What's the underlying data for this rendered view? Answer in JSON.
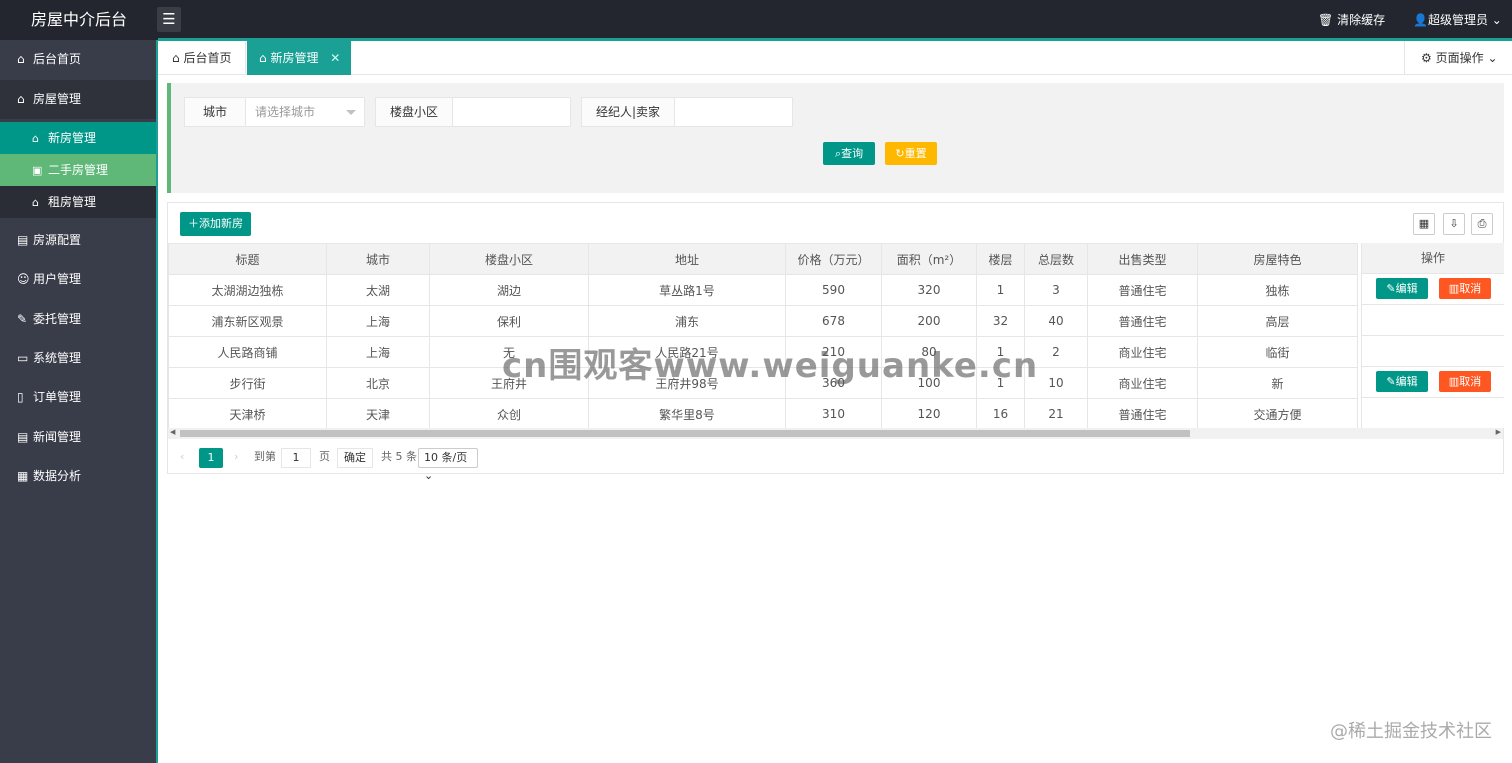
{
  "header": {
    "logo": "房屋中介后台",
    "menu_toggle_icon": "hamburger-icon",
    "clear_cache": "清除缓存",
    "user": "超级管理员"
  },
  "sidebar": {
    "items": [
      {
        "label": "后台首页",
        "icon": "home-icon"
      },
      {
        "label": "房屋管理",
        "icon": "house-icon"
      },
      {
        "label": "房源配置",
        "icon": "config-icon"
      },
      {
        "label": "用户管理",
        "icon": "user-icon"
      },
      {
        "label": "委托管理",
        "icon": "delegate-icon"
      },
      {
        "label": "系统管理",
        "icon": "system-icon"
      },
      {
        "label": "订单管理",
        "icon": "order-icon"
      },
      {
        "label": "新闻管理",
        "icon": "news-icon"
      },
      {
        "label": "数据分析",
        "icon": "chart-icon"
      }
    ],
    "sub_items": [
      {
        "label": "新房管理",
        "icon": "home-icon"
      },
      {
        "label": "二手房管理",
        "icon": "briefcase-icon"
      },
      {
        "label": "租房管理",
        "icon": "house-icon"
      }
    ]
  },
  "tabs": {
    "home": "后台首页",
    "current": "新房管理",
    "close_glyph": "✕",
    "page_ops": "页面操作"
  },
  "search": {
    "city_label": "城市",
    "city_placeholder": "请选择城市",
    "estate_label": "楼盘小区",
    "estate_value": "",
    "agent_label": "经纪人|卖家",
    "agent_value": "",
    "query_btn": "查询",
    "reset_btn": "重置"
  },
  "table": {
    "add_btn": "添加新房",
    "columns": [
      "标题",
      "城市",
      "楼盘小区",
      "地址",
      "价格（万元）",
      "面积（m²）",
      "楼层",
      "总层数",
      "出售类型",
      "房屋特色"
    ],
    "ops_header": "操作",
    "edit_label": "编辑",
    "cancel_label": "取消",
    "rows": [
      [
        "太湖湖边独栋",
        "太湖",
        "湖边",
        "草丛路1号",
        "590",
        "320",
        "1",
        "3",
        "普通住宅",
        "独栋"
      ],
      [
        "浦东新区观景",
        "上海",
        "保利",
        "浦东",
        "678",
        "200",
        "32",
        "40",
        "普通住宅",
        "高层"
      ],
      [
        "人民路商铺",
        "上海",
        "无",
        "人民路21号",
        "210",
        "80",
        "1",
        "2",
        "商业住宅",
        "临街"
      ],
      [
        "步行街",
        "北京",
        "王府井",
        "王府井98号",
        "360",
        "100",
        "1",
        "10",
        "商业住宅",
        "新"
      ],
      [
        "天津桥",
        "天津",
        "众创",
        "繁华里8号",
        "310",
        "120",
        "16",
        "21",
        "普通住宅",
        "交通方便"
      ]
    ],
    "ops_visible": [
      true,
      false,
      false,
      true,
      false
    ]
  },
  "pager": {
    "current": "1",
    "goto": "到第",
    "goto_value": "1",
    "page": "页",
    "ok": "确定",
    "total": "共 5 条",
    "size": "10 条/页"
  },
  "watermark": "cn围观客www.weiguanke.cn",
  "corner_mark": "@稀土掘金技术社区",
  "colors": {
    "primary": "#009688",
    "header_bg": "#23262e",
    "sidebar_bg": "#393d49",
    "sub_hover": "#5fb878",
    "reset": "#ffb800",
    "cancel": "#ff5722"
  }
}
